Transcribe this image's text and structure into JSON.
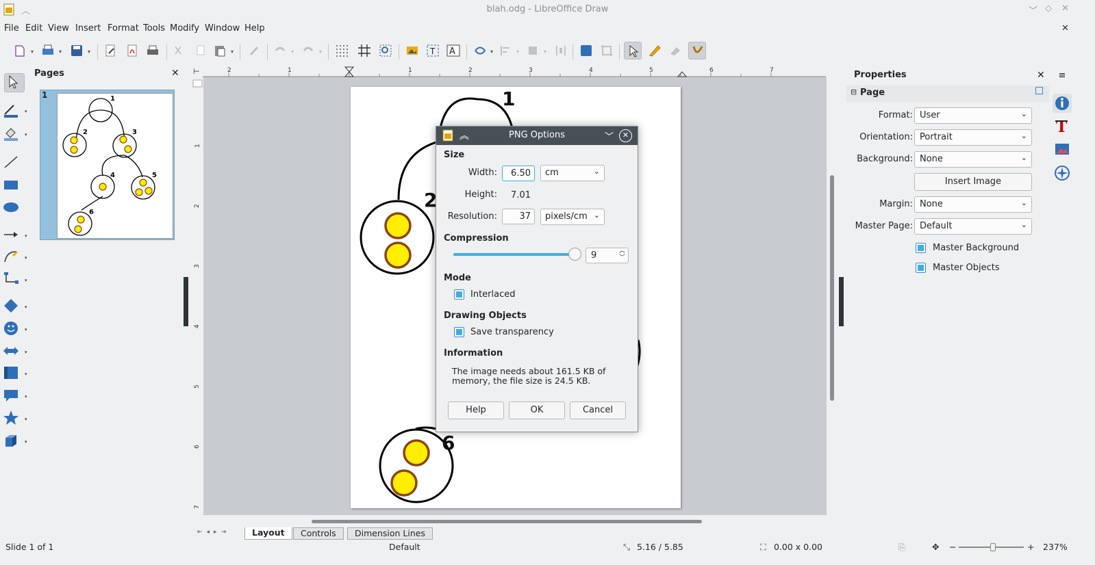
{
  "window": {
    "title": "blah.odg - LibreOffice Draw"
  },
  "menu": [
    "File",
    "Edit",
    "View",
    "Insert",
    "Format",
    "Tools",
    "Modify",
    "Window",
    "Help"
  ],
  "pages_panel": {
    "title": "Pages",
    "page_number": "1",
    "thumb_labels": [
      "1",
      "2",
      "3",
      "4",
      "5",
      "6"
    ]
  },
  "canvas": {
    "labels": [
      "1",
      "2",
      "6"
    ],
    "ruler_h": [
      "2",
      "1",
      "1",
      "2",
      "3",
      "4",
      "5",
      "6",
      "7"
    ],
    "ruler_v": [
      "1",
      "2",
      "3",
      "4",
      "5",
      "6",
      "7"
    ]
  },
  "tabs": [
    "Layout",
    "Controls",
    "Dimension Lines"
  ],
  "properties": {
    "title": "Properties",
    "section": "Page",
    "format_label": "Format:",
    "format_value": "User",
    "orientation_label": "Orientation:",
    "orientation_value": "Portrait",
    "background_label": "Background:",
    "background_value": "None",
    "insert_image": "Insert Image",
    "margin_label": "Margin:",
    "margin_value": "None",
    "master_page_label": "Master Page:",
    "master_page_value": "Default",
    "master_background": "Master Background",
    "master_objects": "Master Objects"
  },
  "dialog": {
    "title": "PNG Options",
    "size_section": "Size",
    "width_label": "Width:",
    "width_value": "6.50",
    "width_unit": "cm",
    "height_label": "Height:",
    "height_value": "7.01",
    "resolution_label": "Resolution:",
    "resolution_value": "37",
    "resolution_unit": "pixels/cm",
    "compression_section": "Compression",
    "compression_value": "9",
    "compression_level": 1.0,
    "mode_section": "Mode",
    "interlaced": "Interlaced",
    "drawing_section": "Drawing Objects",
    "save_transparency": "Save transparency",
    "info_section": "Information",
    "info_line1": "The image needs about 161.5 KB of",
    "info_line2": "memory, the file size is 24.5 KB.",
    "help": "Help",
    "ok": "OK",
    "cancel": "Cancel"
  },
  "status": {
    "slide": "Slide 1 of 1",
    "layout": "Default",
    "position": "5.16 / 5.85",
    "size": "0.00 x 0.00",
    "zoom": "237%"
  },
  "colors": {
    "accent": "#3daee9",
    "dialog_title_bg": "#475057",
    "yellow": "#ffee00",
    "brown": "#8b4513"
  }
}
